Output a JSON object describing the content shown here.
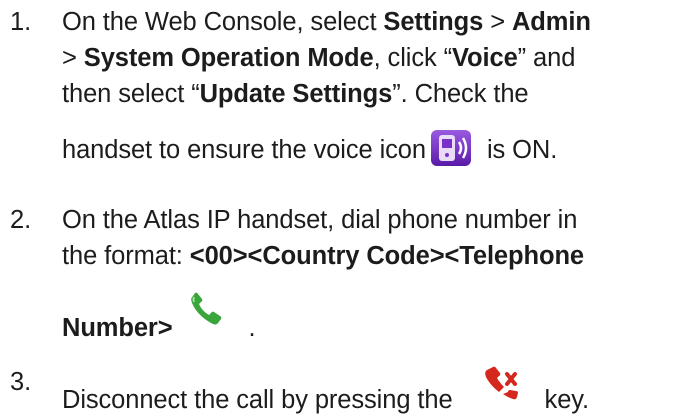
{
  "steps": [
    {
      "number": "1.",
      "line1": {
        "a": "On the Web Console, select ",
        "b1": "Settings",
        "c": " > ",
        "b2": "Admin"
      },
      "line2": {
        "a": "> ",
        "b1": "System Operation Mode",
        "c": ", click “",
        "b2": "Voice",
        "d": "” and"
      },
      "line3": {
        "a": "then select “",
        "b1": "Update Settings",
        "c": "”. Check the"
      },
      "line4": {
        "a": "handset to ensure the voice icon",
        "b": " is ON."
      },
      "icon": "voice-mode-icon"
    },
    {
      "number": "2.",
      "line1": {
        "a": "On the Atlas IP handset, dial phone number in"
      },
      "line2": {
        "a": "the format: ",
        "b1": "<00><Country Code><Telephone"
      },
      "line3": {
        "b1": "Number>",
        "c": "."
      },
      "icon": "call-send-icon"
    },
    {
      "number": "3.",
      "line1": {
        "a": "Disconnect the call by pressing the",
        "b": "key."
      },
      "icon": "call-end-icon"
    }
  ],
  "colors": {
    "text": "#1c1c1c",
    "voice_icon_bg": "#7a2fc8",
    "call_green": "#3aa53a",
    "call_red": "#d4281e"
  }
}
